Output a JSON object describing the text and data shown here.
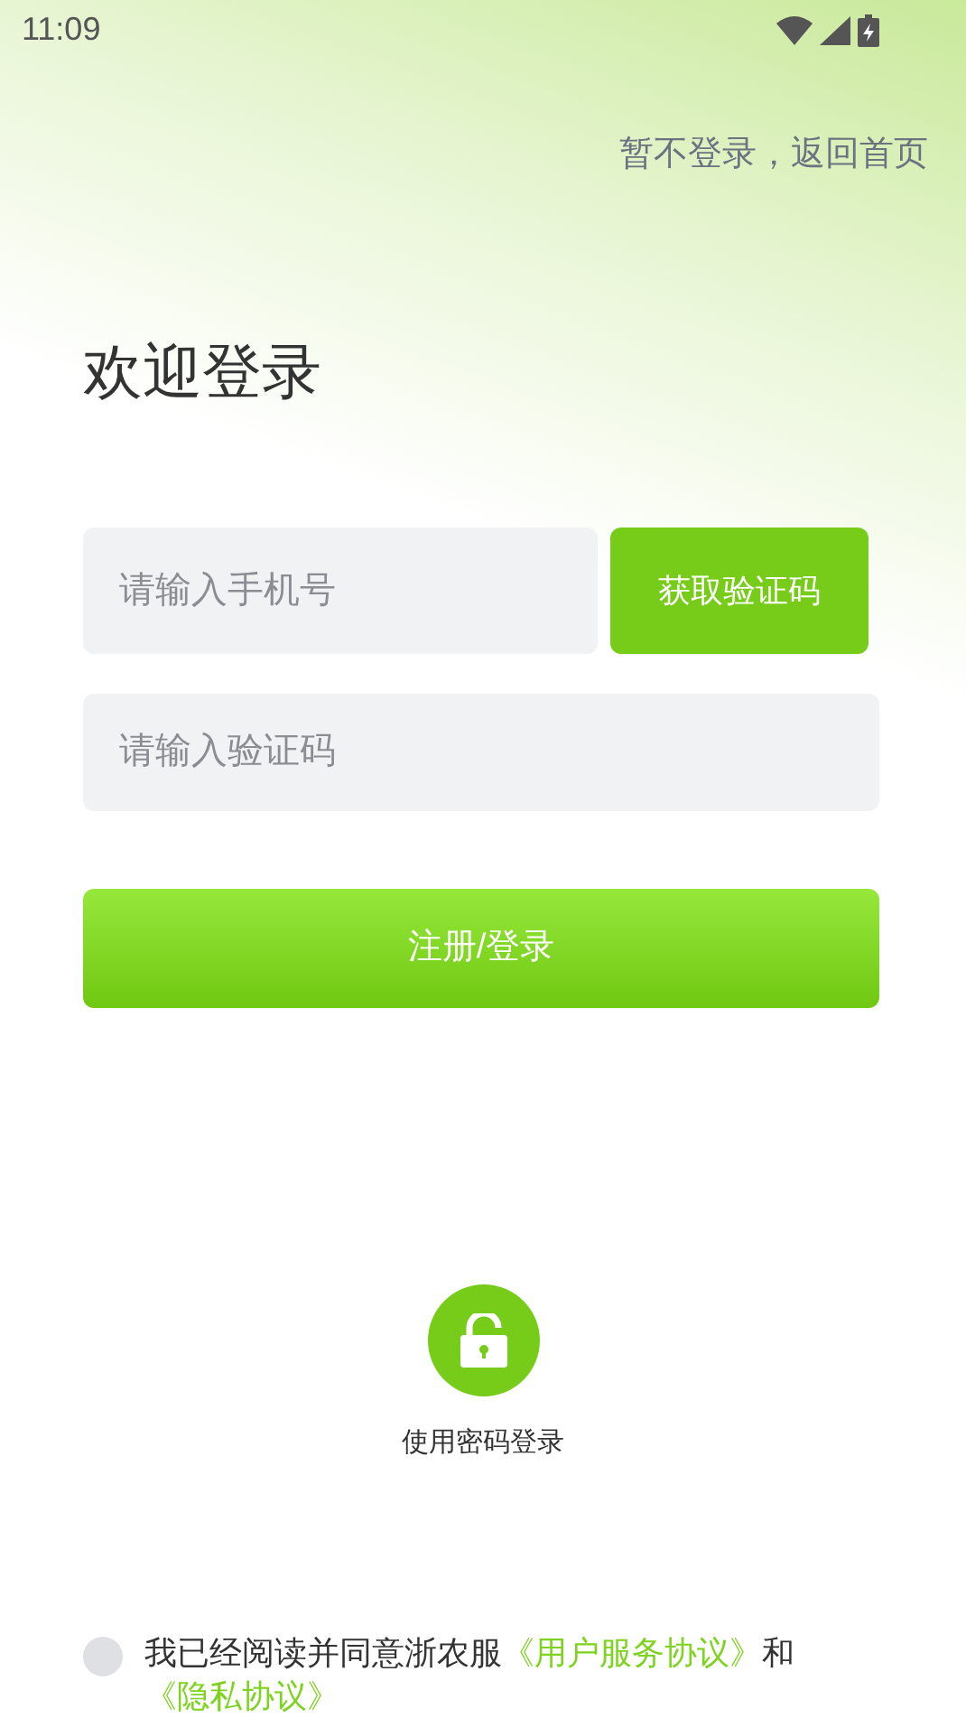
{
  "status_bar": {
    "time": "11:09"
  },
  "skip_link": "暂不登录，返回首页",
  "title": "欢迎登录",
  "phone_field": {
    "placeholder": "请输入手机号"
  },
  "code_button": "获取验证码",
  "code_field": {
    "placeholder": "请输入验证码"
  },
  "login_button": "注册/登录",
  "password_login": {
    "label": "使用密码登录"
  },
  "agreement": {
    "checked": false,
    "text": "我已经阅读并同意浙农服",
    "link_1": "《用户服务协议》",
    "connector": "和",
    "link_2": "《隐私协议》"
  }
}
